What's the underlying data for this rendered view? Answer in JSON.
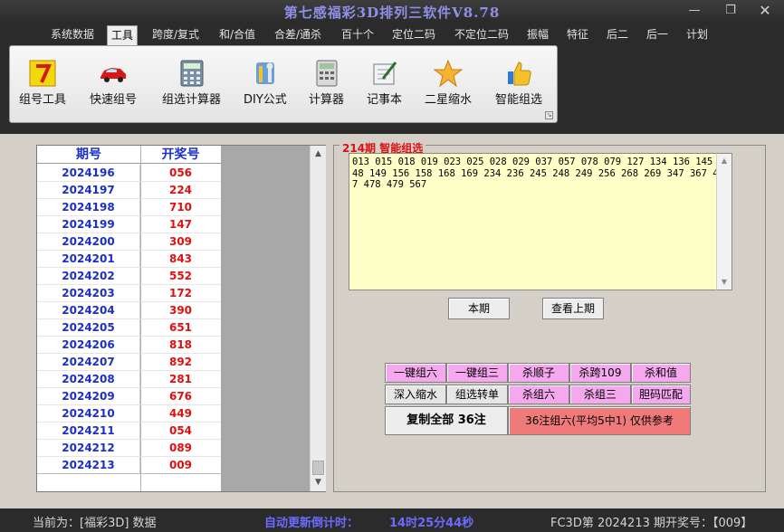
{
  "window": {
    "title": "第七感福彩3D排列三软件V8.78",
    "min_label": "—",
    "max_label": "❐",
    "close_label": "✕"
  },
  "menu": [
    {
      "label": "系统数据"
    },
    {
      "label": "工具",
      "active": true
    },
    {
      "label": "跨度/复式"
    },
    {
      "label": "和/合值"
    },
    {
      "label": "合差/通杀"
    },
    {
      "label": "百十个"
    },
    {
      "label": "定位二码"
    },
    {
      "label": "不定位二码"
    },
    {
      "label": "振幅"
    },
    {
      "label": "特征"
    },
    {
      "label": "后二"
    },
    {
      "label": "后一"
    },
    {
      "label": "计划"
    }
  ],
  "ribbon": {
    "tools": [
      {
        "label": "组号工具",
        "icon": "number-seven-icon"
      },
      {
        "label": "快速组号",
        "icon": "car-icon"
      },
      {
        "label": "组选计算器",
        "icon": "calculator-icon"
      },
      {
        "label": "DIY公式",
        "icon": "wrench-screwdriver-icon"
      },
      {
        "label": "计算器",
        "icon": "calculator-icon"
      },
      {
        "label": "记事本",
        "icon": "notepad-pen-icon"
      },
      {
        "label": "二星缩水",
        "icon": "star-icon"
      },
      {
        "label": "智能组选",
        "icon": "thumbs-up-icon"
      }
    ],
    "corner_glyph": "↘"
  },
  "history": {
    "col_period": "期号",
    "col_number": "开奖号",
    "rows": [
      {
        "period": "2024196",
        "number": "056"
      },
      {
        "period": "2024197",
        "number": "224"
      },
      {
        "period": "2024198",
        "number": "710"
      },
      {
        "period": "2024199",
        "number": "147"
      },
      {
        "period": "2024200",
        "number": "309"
      },
      {
        "period": "2024201",
        "number": "843"
      },
      {
        "period": "2024202",
        "number": "552"
      },
      {
        "period": "2024203",
        "number": "172"
      },
      {
        "period": "2024204",
        "number": "390"
      },
      {
        "period": "2024205",
        "number": "651"
      },
      {
        "period": "2024206",
        "number": "818"
      },
      {
        "period": "2024207",
        "number": "892"
      },
      {
        "period": "2024208",
        "number": "281"
      },
      {
        "period": "2024209",
        "number": "676"
      },
      {
        "period": "2024210",
        "number": "449"
      },
      {
        "period": "2024211",
        "number": "054"
      },
      {
        "period": "2024212",
        "number": "089"
      },
      {
        "period": "2024213",
        "number": "009"
      }
    ]
  },
  "smart": {
    "group_title": "214期 智能组选",
    "result_text": "013 015 018 019 023 025 028 029 037 057 078 079 127 134 136 145 148 149 156 158 168 169 234 236 245 248 249 256 268 269 347 367 457 478 479 567",
    "btn_current": "本期",
    "btn_prev": "查看上期",
    "actions_row1": [
      "一键组六",
      "一键组三",
      "杀顺子",
      "杀跨109",
      "杀和值"
    ],
    "actions_row2": [
      "深入缩水",
      "组选转单",
      "杀组六",
      "杀组三",
      "胆码匹配"
    ],
    "copy_all": "复制全部 36注",
    "summary": "36注组六(平均5中1) 仅供参考"
  },
  "status": {
    "current": "当前为：[福彩3D] 数据",
    "countdown_label": "自动更新倒计时：",
    "countdown_value": "14时25分44秒",
    "latest": "FC3D第 2024213 期开奖号：【009】"
  },
  "colors": {
    "accent_blue": "#1c2fc8",
    "draw_red": "#e01010",
    "pink_button": "#f5a8ee",
    "red_button": "#f07979",
    "result_bg": "#ffffc8"
  }
}
